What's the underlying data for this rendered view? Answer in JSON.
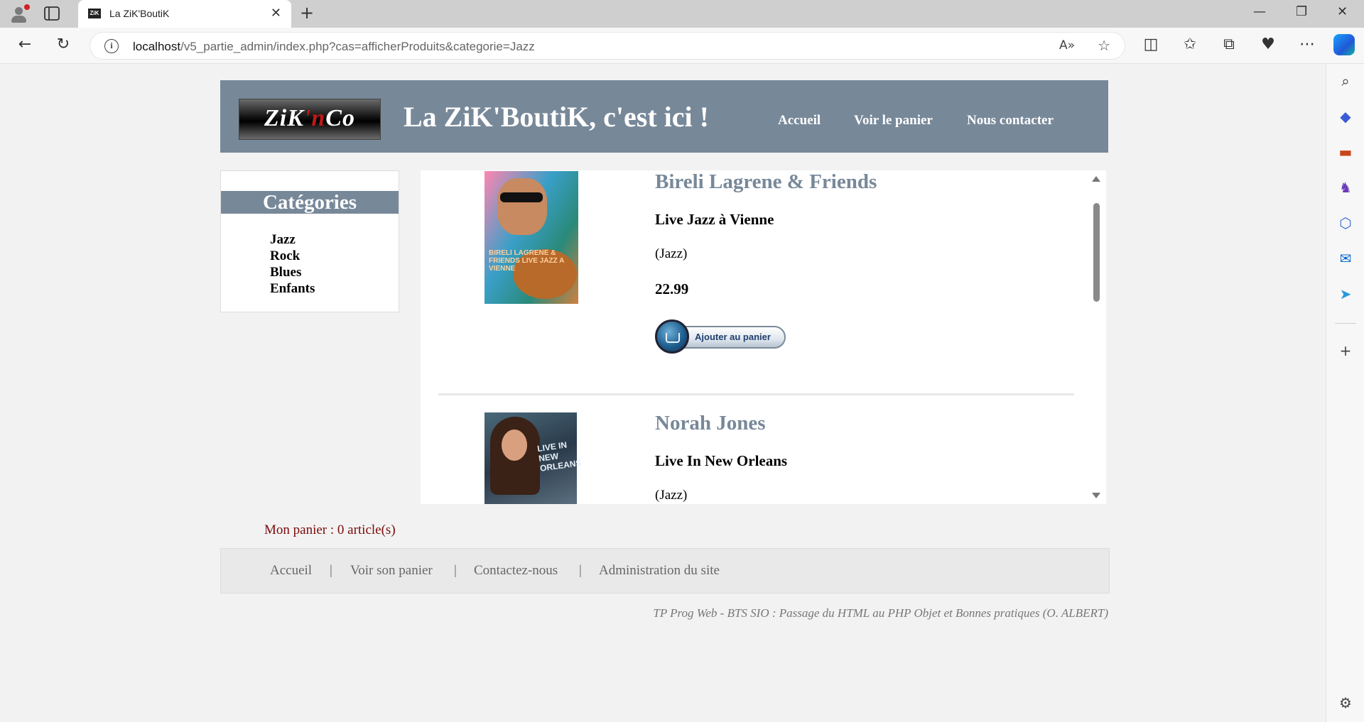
{
  "browser": {
    "tab_title": "La ZiK'BoutiK",
    "tab_favicon": "ZiK",
    "url_host": "localhost",
    "url_path": "/v5_partie_admin/index.php?cas=afficherProduits&categorie=Jazz",
    "read_aloud_label": "A)"
  },
  "header": {
    "logo_text_a": "ZiK",
    "logo_text_b": "'n",
    "logo_text_c": "Co",
    "title": "La ZiK'BoutiK, c'est ici !",
    "nav": [
      "Accueil",
      "Voir le panier",
      "Nous contacter"
    ]
  },
  "categories": {
    "title": "Catégories",
    "items": [
      "Jazz",
      "Rock",
      "Blues",
      "Enfants"
    ]
  },
  "products": [
    {
      "artist": "Bireli Lagrene & Friends",
      "album": "Live Jazz à Vienne",
      "category": "(Jazz)",
      "price": "22.99",
      "cover_text": "BIRELI LAGRENE & FRIENDS LIVE JAZZ A VIENNE",
      "add_label": "Ajouter au panier"
    },
    {
      "artist": "Norah Jones",
      "album": "Live In New Orleans",
      "category": "(Jazz)",
      "cover_text": "LIVE IN NEW ORLEANS"
    }
  ],
  "cart": {
    "text": "Mon panier : 0 article(s)"
  },
  "footer": {
    "links": [
      "Accueil",
      "Voir son panier",
      "Contactez-nous",
      "Administration du site"
    ],
    "separator": "|",
    "credit": "TP Prog Web - BTS SIO : Passage du HTML au PHP Objet et Bonnes pratiques (O. ALBERT)"
  },
  "colors": {
    "header_bg": "#778899",
    "artist_text": "#778899",
    "cart_text": "#7a0a0a"
  }
}
